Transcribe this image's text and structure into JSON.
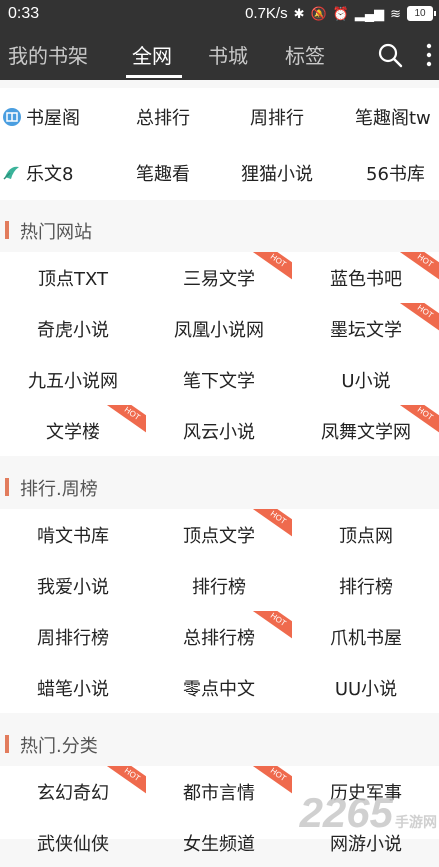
{
  "status": {
    "time": "0:33",
    "speed": "0.7K/s",
    "battery": "10"
  },
  "nav": {
    "tabs": [
      "我的书架",
      "全网",
      "书城",
      "标签"
    ],
    "active": "全网"
  },
  "quick_row1": [
    "书屋阁",
    "总排行",
    "周排行",
    "笔趣阁tw"
  ],
  "quick_row2": [
    "乐文8",
    "笔趣看",
    "狸猫小说",
    "56书库"
  ],
  "sections": [
    {
      "title": "热门网站",
      "rows": [
        [
          {
            "label": "顶点TXT",
            "hot": false
          },
          {
            "label": "三易文学",
            "hot": true
          },
          {
            "label": "蓝色书吧",
            "hot": true
          }
        ],
        [
          {
            "label": "奇虎小说",
            "hot": false
          },
          {
            "label": "凤凰小说网",
            "hot": false
          },
          {
            "label": "墨坛文学",
            "hot": true
          }
        ],
        [
          {
            "label": "九五小说网",
            "hot": false
          },
          {
            "label": "笔下文学",
            "hot": false
          },
          {
            "label": "U小说",
            "hot": false
          }
        ],
        [
          {
            "label": "文学楼",
            "hot": true
          },
          {
            "label": "风云小说",
            "hot": false
          },
          {
            "label": "凤舞文学网",
            "hot": true
          }
        ]
      ]
    },
    {
      "title": "排行.周榜",
      "rows": [
        [
          {
            "label": "啃文书库",
            "hot": false
          },
          {
            "label": "顶点文学",
            "hot": true
          },
          {
            "label": "顶点网",
            "hot": false
          }
        ],
        [
          {
            "label": "我爱小说",
            "hot": false
          },
          {
            "label": "排行榜",
            "hot": false
          },
          {
            "label": "排行榜",
            "hot": false
          }
        ],
        [
          {
            "label": "周排行榜",
            "hot": false
          },
          {
            "label": "总排行榜",
            "hot": true
          },
          {
            "label": "爪机书屋",
            "hot": false
          }
        ],
        [
          {
            "label": "蜡笔小说",
            "hot": false
          },
          {
            "label": "零点中文",
            "hot": false
          },
          {
            "label": "UU小说",
            "hot": false
          }
        ]
      ]
    },
    {
      "title": "热门.分类",
      "rows": [
        [
          {
            "label": "玄幻奇幻",
            "hot": true
          },
          {
            "label": "都市言情",
            "hot": true
          },
          {
            "label": "历史军事",
            "hot": false
          }
        ],
        [
          {
            "label": "武侠仙侠",
            "hot": false
          },
          {
            "label": "女生频道",
            "hot": false
          },
          {
            "label": "网游小说",
            "hot": false
          }
        ]
      ]
    }
  ],
  "hot_badge_text": "HOT",
  "watermark": {
    "number": "2265",
    "text": "手游网"
  },
  "colors": {
    "nav_bg": "#333333",
    "accent": "#e27c5d",
    "hot_badge": "#ef6a4d"
  },
  "icons": {
    "search": "search-icon",
    "more": "more-vertical-icon"
  }
}
